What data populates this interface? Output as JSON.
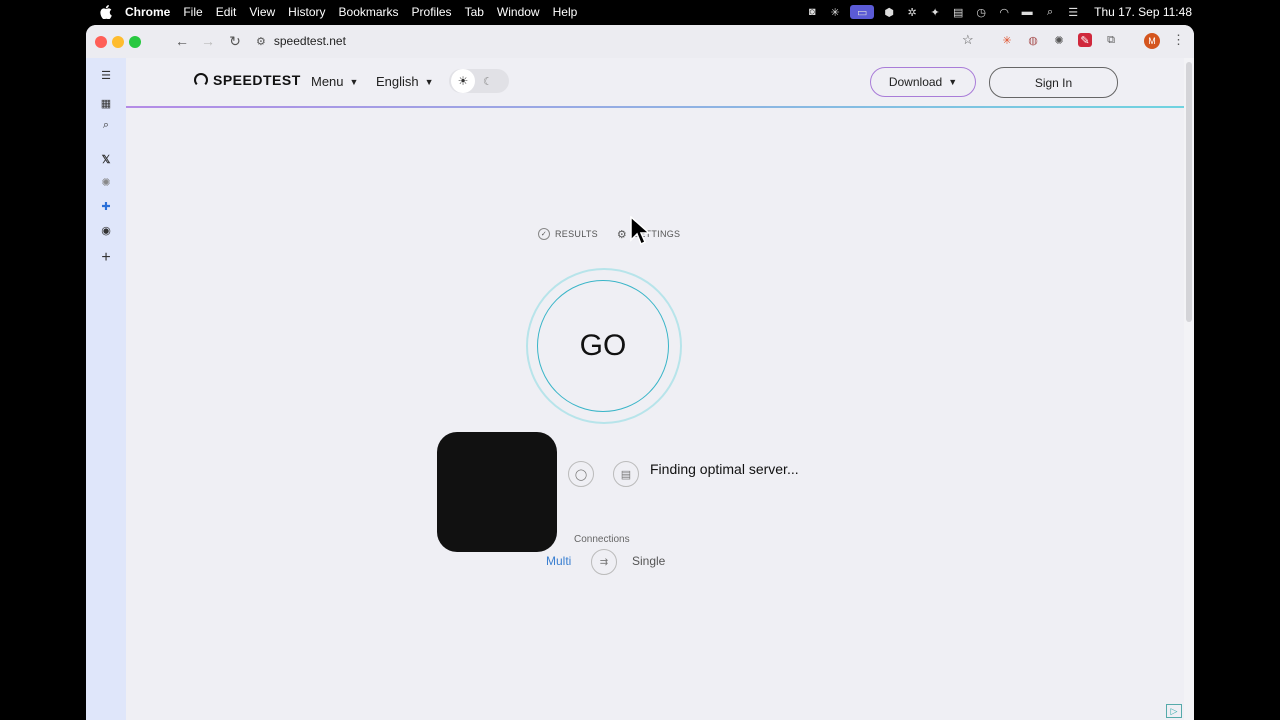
{
  "menubar": {
    "app": "Chrome",
    "items": [
      "File",
      "Edit",
      "View",
      "History",
      "Bookmarks",
      "Profiles",
      "Tab",
      "Window",
      "Help"
    ],
    "clock": "Thu 17. Sep  11:48"
  },
  "browser": {
    "url": "speedtest.net",
    "profile_initial": "M"
  },
  "header": {
    "logo": "SPEEDTEST",
    "menu_label": "Menu",
    "language_label": "English",
    "download_label": "Download",
    "signin_label": "Sign In"
  },
  "main": {
    "tabs": [
      {
        "label": "RESULTS",
        "icon": "check-circle-icon"
      },
      {
        "label": "SETTINGS",
        "icon": "gear-icon"
      }
    ],
    "go_label": "GO",
    "status_text": "Finding optimal server...",
    "connections": {
      "label": "Connections",
      "multi": "Multi",
      "single": "Single",
      "selected": "Multi"
    }
  },
  "colors": {
    "accent_blue": "#3a7fd0",
    "go_ring": "#3ab5c8",
    "sidebar_bg": "#dfe6fa",
    "download_border": "#a97cd8"
  }
}
